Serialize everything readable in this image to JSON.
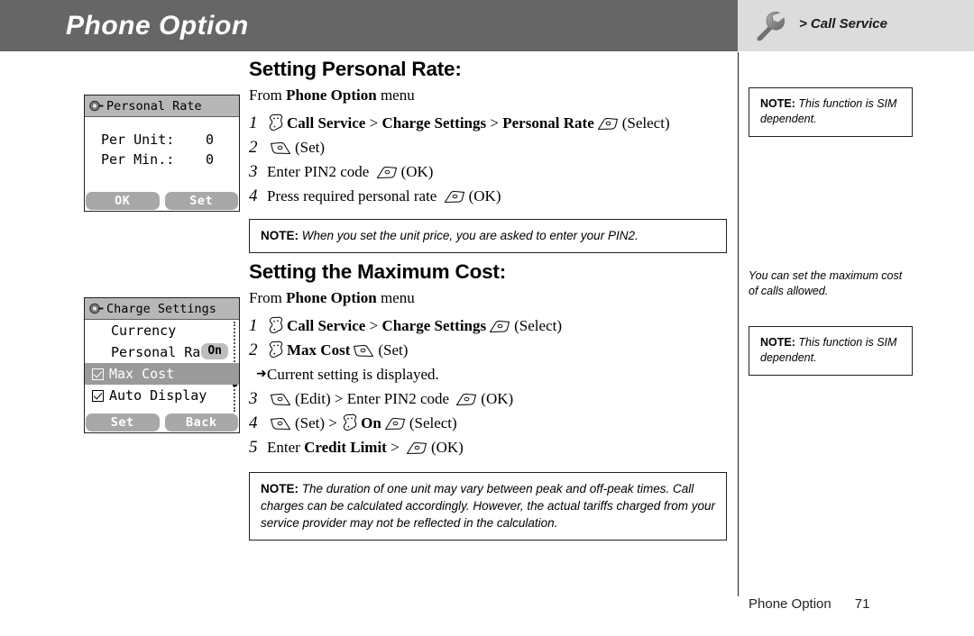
{
  "header": {
    "title": "Phone Option",
    "breadcrumb": "> Call Service",
    "icon": "wrench-icon",
    "bar_color": "#666666",
    "right_bg_color": "#dcdcdc"
  },
  "phone_screens": [
    {
      "title": "Personal Rate",
      "rows": [
        {
          "label": "Per Unit:",
          "value": "0"
        },
        {
          "label": "Per Min.:",
          "value": "0"
        }
      ],
      "softkeys": [
        "OK",
        "Set"
      ]
    },
    {
      "title": "Charge Settings",
      "items": [
        {
          "label": "Currency",
          "checkbox": "none",
          "selected": false,
          "badge": null
        },
        {
          "label": "Personal Rate",
          "checkbox": "none",
          "selected": false,
          "badge": "On"
        },
        {
          "label": "Max Cost",
          "checkbox": "checked",
          "selected": true,
          "badge": null
        },
        {
          "label": "Auto Display",
          "checkbox": "checked",
          "selected": false,
          "badge": null
        }
      ],
      "softkeys": [
        "Set",
        "Back"
      ]
    }
  ],
  "sections": [
    {
      "heading": "Setting Personal Rate:",
      "from_prefix": "From ",
      "from_bold": "Phone Option",
      "from_suffix": " menu",
      "steps": [
        {
          "num": "1",
          "parts": [
            {
              "type": "icon",
              "icon": "nav-key-icon"
            },
            {
              "type": "bold",
              "text": "Call Service"
            },
            {
              "type": "text",
              "text": " > "
            },
            {
              "type": "bold",
              "text": "Charge Settings"
            },
            {
              "type": "text",
              "text": " > "
            },
            {
              "type": "bold",
              "text": "Personal Rate"
            },
            {
              "type": "icon",
              "icon": "right-softkey-icon"
            },
            {
              "type": "text",
              "text": "(Select)"
            }
          ]
        },
        {
          "num": "2",
          "parts": [
            {
              "type": "icon",
              "icon": "left-softkey-icon"
            },
            {
              "type": "text",
              "text": "(Set)"
            }
          ]
        },
        {
          "num": "3",
          "parts": [
            {
              "type": "text",
              "text": "Enter PIN2 code "
            },
            {
              "type": "icon",
              "icon": "right-softkey-icon"
            },
            {
              "type": "text",
              "text": "(OK)"
            }
          ]
        },
        {
          "num": "4",
          "parts": [
            {
              "type": "text",
              "text": "Press required personal rate "
            },
            {
              "type": "icon",
              "icon": "right-softkey-icon"
            },
            {
              "type": "text",
              "text": "(OK)"
            }
          ]
        }
      ],
      "note": {
        "label": "NOTE:",
        "text": " When you set the unit price, you are asked to enter your PIN2."
      }
    },
    {
      "heading": "Setting the Maximum Cost:",
      "from_prefix": "From ",
      "from_bold": "Phone Option",
      "from_suffix": " menu",
      "steps": [
        {
          "num": "1",
          "parts": [
            {
              "type": "icon",
              "icon": "nav-key-icon"
            },
            {
              "type": "bold",
              "text": "Call Service"
            },
            {
              "type": "text",
              "text": " > "
            },
            {
              "type": "bold",
              "text": "Charge Settings"
            },
            {
              "type": "icon",
              "icon": "right-softkey-icon"
            },
            {
              "type": "text",
              "text": "(Select)"
            }
          ]
        },
        {
          "num": "2",
          "parts": [
            {
              "type": "icon",
              "icon": "nav-key-icon"
            },
            {
              "type": "bold",
              "text": "Max Cost"
            },
            {
              "type": "icon",
              "icon": "left-softkey-icon"
            },
            {
              "type": "text",
              "text": "(Set)"
            }
          ]
        },
        {
          "num": "",
          "subnote": true,
          "parts": [
            {
              "type": "text",
              "text": "Current setting is displayed."
            }
          ]
        },
        {
          "num": "3",
          "parts": [
            {
              "type": "icon",
              "icon": "left-softkey-icon"
            },
            {
              "type": "text",
              "text": "(Edit) > Enter PIN2 code "
            },
            {
              "type": "icon",
              "icon": "right-softkey-icon"
            },
            {
              "type": "text",
              "text": "(OK)"
            }
          ]
        },
        {
          "num": "4",
          "parts": [
            {
              "type": "icon",
              "icon": "left-softkey-icon"
            },
            {
              "type": "text",
              "text": "(Set) > "
            },
            {
              "type": "icon",
              "icon": "nav-key-icon"
            },
            {
              "type": "bold",
              "text": "On"
            },
            {
              "type": "icon",
              "icon": "right-softkey-icon"
            },
            {
              "type": "text",
              "text": "(Select)"
            }
          ]
        },
        {
          "num": "5",
          "parts": [
            {
              "type": "text",
              "text": "Enter "
            },
            {
              "type": "bold",
              "text": "Credit Limit"
            },
            {
              "type": "text",
              "text": " > "
            },
            {
              "type": "icon",
              "icon": "right-softkey-icon"
            },
            {
              "type": "text",
              "text": "(OK)"
            }
          ]
        }
      ],
      "note": {
        "label": "NOTE:",
        "text": " The duration of one unit may vary between peak and off-peak times. Call charges can be calculated accordingly. However, the actual tariffs charged from your service provider may not be reflected in the calculation."
      }
    }
  ],
  "sidebar": {
    "note_top": {
      "label": "NOTE:",
      "text": " This function is SIM dependent."
    },
    "paragraph": "You can set the maximum cost of calls allowed.",
    "note_bottom": {
      "label": "NOTE:",
      "text": " This function is SIM dependent."
    }
  },
  "footer": {
    "label": "Phone Option",
    "page": "71"
  }
}
